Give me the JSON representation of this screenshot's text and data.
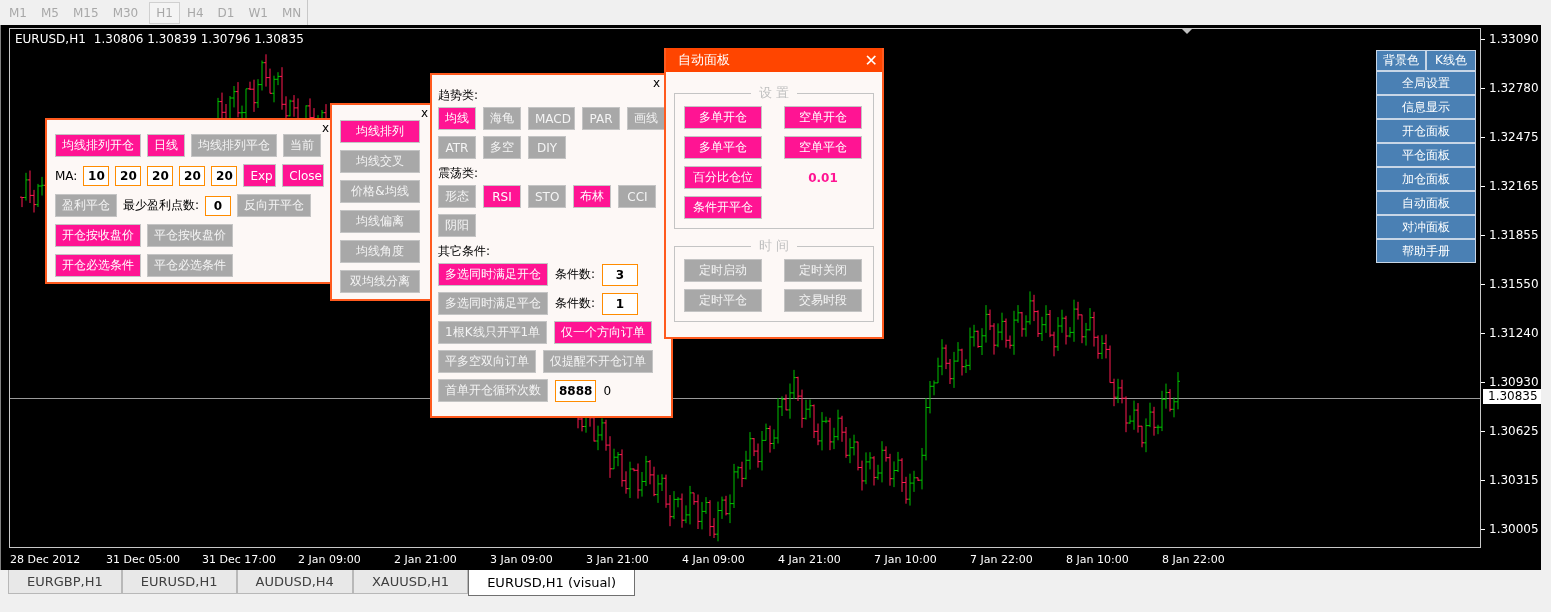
{
  "timeframes": [
    {
      "label": "M1",
      "selected": false
    },
    {
      "label": "M5",
      "selected": false
    },
    {
      "label": "M15",
      "selected": false
    },
    {
      "label": "M30",
      "selected": false
    },
    {
      "label": "H1",
      "selected": true
    },
    {
      "label": "H4",
      "selected": false
    },
    {
      "label": "D1",
      "selected": false
    },
    {
      "label": "W1",
      "selected": false
    },
    {
      "label": "MN",
      "selected": false
    }
  ],
  "chart": {
    "symbol": "EURUSD,H1",
    "ohlc": "1.30806 1.30839 1.30796 1.30835",
    "current_price": "1.30835",
    "price_axis": [
      "1.33090",
      "1.32780",
      "1.32475",
      "1.32165",
      "1.31855",
      "1.31550",
      "1.31240",
      "1.30930",
      "1.30625",
      "1.30315",
      "1.30005"
    ],
    "time_axis": [
      "28 Dec 2012",
      "31 Dec 05:00",
      "31 Dec 17:00",
      "2 Jan 09:00",
      "2 Jan 21:00",
      "3 Jan 09:00",
      "3 Jan 21:00",
      "4 Jan 09:00",
      "4 Jan 21:00",
      "7 Jan 10:00",
      "7 Jan 22:00",
      "8 Jan 10:00",
      "8 Jan 22:00"
    ]
  },
  "quick_menu": {
    "color_buttons": [
      "背景色",
      "K线色"
    ],
    "items": [
      "全局设置",
      "信息显示",
      "开仓面板",
      "平仓面板",
      "加仓面板",
      "自动面板",
      "对冲面板",
      "帮助手册"
    ]
  },
  "ma_panel": {
    "close": "x",
    "rows": [
      {
        "items": [
          {
            "kind": "button",
            "label": "均线排列开仓",
            "on": true
          },
          {
            "kind": "button",
            "label": "日线",
            "on": true
          },
          {
            "kind": "button",
            "label": "均线排列平仓",
            "on": false
          },
          {
            "kind": "button",
            "label": "当前",
            "on": false
          }
        ]
      },
      {
        "items": [
          {
            "kind": "label",
            "text": "MA:"
          },
          {
            "kind": "input",
            "value": "10"
          },
          {
            "kind": "input",
            "value": "20"
          },
          {
            "kind": "input",
            "value": "20"
          },
          {
            "kind": "input",
            "value": "20"
          },
          {
            "kind": "input",
            "value": "20"
          },
          {
            "kind": "button",
            "label": "Exp",
            "on": true
          },
          {
            "kind": "button",
            "label": "Close",
            "on": true
          }
        ]
      },
      {
        "items": [
          {
            "kind": "button",
            "label": "盈利平仓",
            "on": false
          },
          {
            "kind": "label",
            "text": "最少盈利点数:"
          },
          {
            "kind": "input",
            "value": "0"
          },
          {
            "kind": "button",
            "label": "反向开平仓",
            "on": false
          }
        ]
      },
      {
        "items": [
          {
            "kind": "button",
            "label": "开仓按收盘价",
            "on": true
          },
          {
            "kind": "button",
            "label": "平仓按收盘价",
            "on": false
          }
        ]
      },
      {
        "items": [
          {
            "kind": "button",
            "label": "开仓必选条件",
            "on": true
          },
          {
            "kind": "button",
            "label": "平仓必选条件",
            "on": false
          }
        ]
      }
    ]
  },
  "ma_type_panel": {
    "close": "x",
    "buttons": [
      {
        "label": "均线排列",
        "on": true
      },
      {
        "label": "均线交叉",
        "on": false
      },
      {
        "label": "价格&均线",
        "on": false
      },
      {
        "label": "均线偏离",
        "on": false
      },
      {
        "label": "均线角度",
        "on": false
      },
      {
        "label": "双均线分离",
        "on": false
      }
    ]
  },
  "condition_panel": {
    "close": "x",
    "rows": [
      {
        "items": [
          {
            "kind": "heading",
            "text": "趋势类:"
          }
        ]
      },
      {
        "items": [
          {
            "kind": "button",
            "label": "均线",
            "on": true
          },
          {
            "kind": "button",
            "label": "海龟",
            "on": false
          },
          {
            "kind": "button",
            "label": "MACD",
            "on": false
          },
          {
            "kind": "button",
            "label": "PAR",
            "on": false
          },
          {
            "kind": "button",
            "label": "画线",
            "on": false
          }
        ]
      },
      {
        "items": [
          {
            "kind": "button",
            "label": "ATR",
            "on": false
          },
          {
            "kind": "button",
            "label": "多空",
            "on": false
          },
          {
            "kind": "button",
            "label": "DIY",
            "on": false
          }
        ]
      },
      {
        "items": [
          {
            "kind": "heading",
            "text": "震荡类:"
          }
        ]
      },
      {
        "items": [
          {
            "kind": "button",
            "label": "形态",
            "on": false
          },
          {
            "kind": "button",
            "label": "RSI",
            "on": true
          },
          {
            "kind": "button",
            "label": "STO",
            "on": false
          },
          {
            "kind": "button",
            "label": "布林",
            "on": true
          },
          {
            "kind": "button",
            "label": "CCI",
            "on": false
          }
        ]
      },
      {
        "items": [
          {
            "kind": "button",
            "label": "阴阳",
            "on": false
          }
        ]
      },
      {
        "items": [
          {
            "kind": "heading",
            "text": "其它条件:"
          }
        ]
      },
      {
        "items": [
          {
            "kind": "button",
            "label": "多选同时满足开仓",
            "on": true
          },
          {
            "kind": "label",
            "text": "条件数:"
          },
          {
            "kind": "input",
            "value": "3"
          }
        ]
      },
      {
        "items": [
          {
            "kind": "button",
            "label": "多选同时满足平仓",
            "on": false
          },
          {
            "kind": "label",
            "text": "条件数:"
          },
          {
            "kind": "input",
            "value": "1"
          }
        ]
      },
      {
        "items": [
          {
            "kind": "button",
            "label": "1根K线只开平1单",
            "on": false
          },
          {
            "kind": "button",
            "label": "仅一个方向订单",
            "on": true
          }
        ]
      },
      {
        "items": [
          {
            "kind": "button",
            "label": "平多空双向订单",
            "on": false
          },
          {
            "kind": "button",
            "label": "仅提醒不开仓订单",
            "on": false
          }
        ]
      },
      {
        "items": [
          {
            "kind": "button",
            "label": "首单开仓循环次数",
            "on": false
          },
          {
            "kind": "input",
            "value": "8888"
          },
          {
            "kind": "label",
            "text": "0"
          }
        ]
      }
    ]
  },
  "auto_panel": {
    "title": "自动面板",
    "close": "✕",
    "groups": [
      {
        "legend": "设 置",
        "items": [
          {
            "kind": "button",
            "label": "多单开仓",
            "on": true
          },
          {
            "kind": "button",
            "label": "空单开仓",
            "on": true
          },
          {
            "kind": "button",
            "label": "多单平仓",
            "on": true
          },
          {
            "kind": "button",
            "label": "空单平仓",
            "on": true
          },
          {
            "kind": "button",
            "label": "百分比仓位",
            "on": true
          },
          {
            "kind": "value",
            "text": "0.01"
          },
          {
            "kind": "button",
            "label": "条件开平仓",
            "on": true
          }
        ]
      },
      {
        "legend": "时 间",
        "items": [
          {
            "kind": "button",
            "label": "定时启动",
            "on": false
          },
          {
            "kind": "button",
            "label": "定时关闭",
            "on": false
          },
          {
            "kind": "button",
            "label": "定时平仓",
            "on": false
          },
          {
            "kind": "button",
            "label": "交易时段",
            "on": false
          }
        ]
      }
    ]
  },
  "tabs": [
    {
      "label": "EURGBP,H1",
      "selected": false
    },
    {
      "label": "EURUSD,H1",
      "selected": false
    },
    {
      "label": "AUDUSD,H4",
      "selected": false
    },
    {
      "label": "XAUUSD,H1",
      "selected": false
    },
    {
      "label": "EURUSD,H1 (visual)",
      "selected": true
    }
  ]
}
